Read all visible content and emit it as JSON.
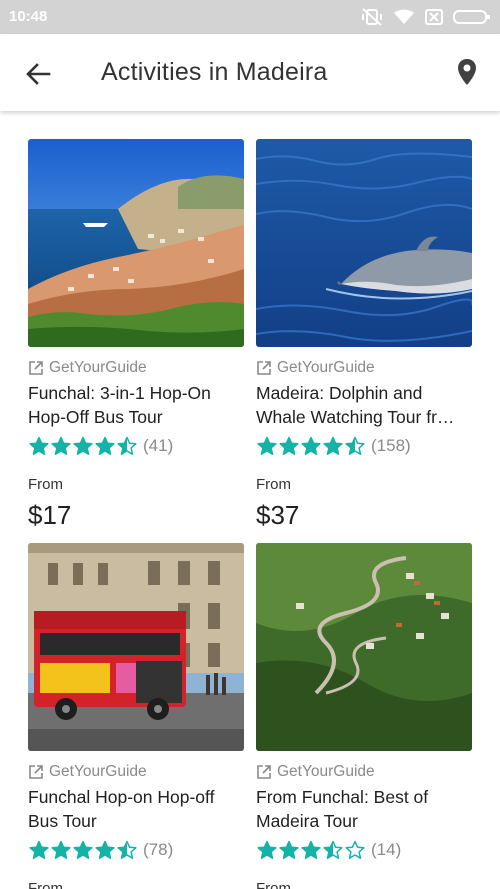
{
  "status_bar": {
    "time": "10:48"
  },
  "header": {
    "title": "Activities in Madeira"
  },
  "colors": {
    "star": "#14b3a8",
    "star_empty_stroke": "#14b3a8",
    "provider_text": "#8a8a8a"
  },
  "activities": [
    {
      "provider": "GetYourGuide",
      "title": "Funchal: 3-in-1 Hop-On Hop-Off Bus Tour",
      "rating": 4.5,
      "reviews": "(41)",
      "from_label": "From",
      "price": "$17",
      "image": "coastal-city"
    },
    {
      "provider": "GetYourGuide",
      "title": "Madeira: Dolphin and Whale Watching Tour fr…",
      "rating": 4.5,
      "reviews": "(158)",
      "from_label": "From",
      "price": "$37",
      "image": "dolphin"
    },
    {
      "provider": "GetYourGuide",
      "title": "Funchal Hop-on Hop-off Bus Tour",
      "rating": 4.5,
      "reviews": "(78)",
      "from_label": "From",
      "price": "",
      "image": "red-bus"
    },
    {
      "provider": "GetYourGuide",
      "title": "From Funchal: Best of Madeira Tour",
      "rating": 3.5,
      "reviews": "(14)",
      "from_label": "From",
      "price": "",
      "image": "mountain-road"
    }
  ]
}
